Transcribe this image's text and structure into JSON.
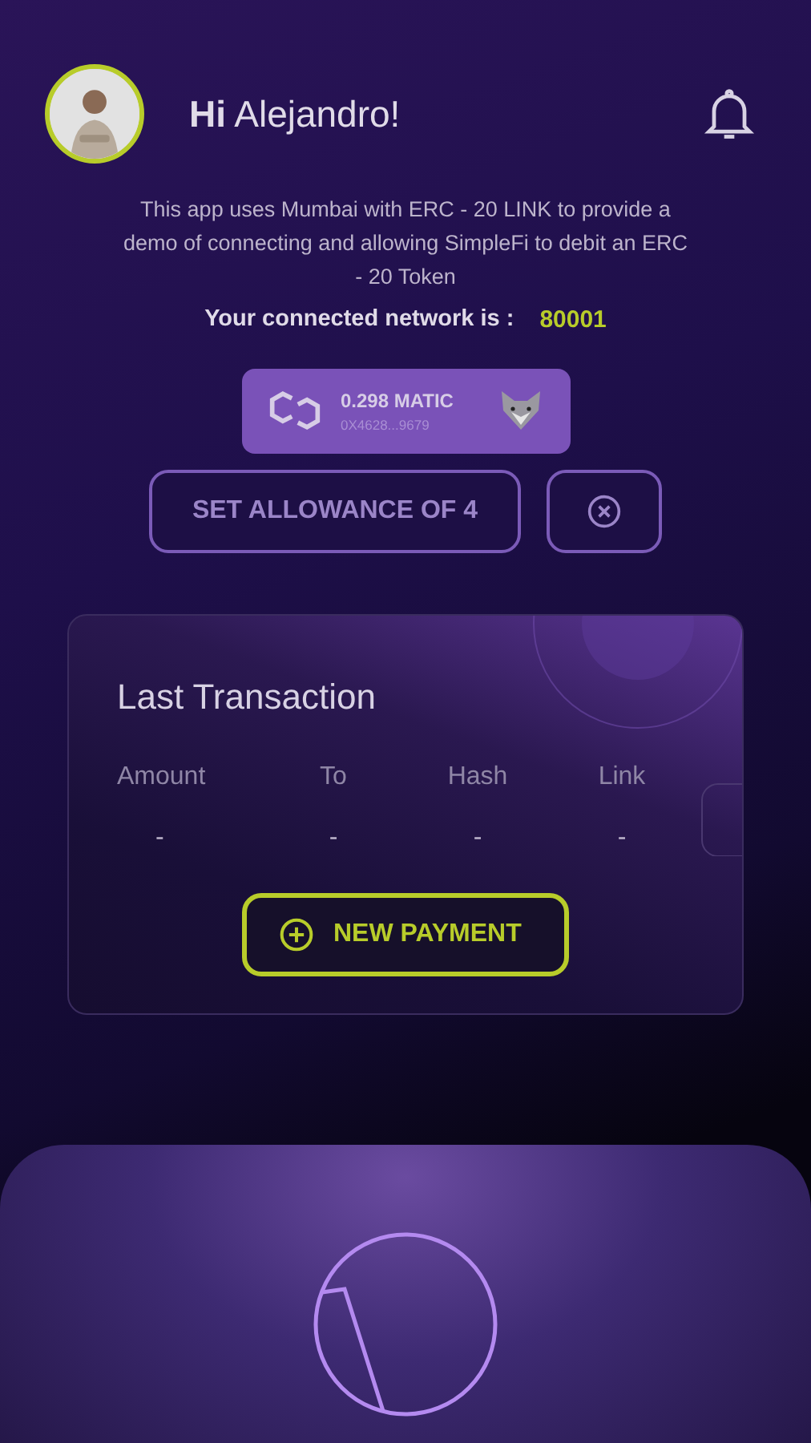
{
  "header": {
    "greeting_prefix": "Hi",
    "name": "Alejandro!"
  },
  "intro": "This app uses Mumbai with ERC - 20 LINK to provide a demo of connecting and allowing SimpleFi to debit an  ERC - 20 Token",
  "network": {
    "label": "Your connected network is :",
    "value": "80001"
  },
  "wallet": {
    "balance": "0.298 MATIC",
    "address": "0X4628...9679"
  },
  "allowance_button": "SET ALLOWANCE OF 4",
  "last_transaction": {
    "title": "Last Transaction",
    "columns": [
      "Amount",
      "To",
      "Hash",
      "Link"
    ],
    "values": [
      "-",
      "-",
      "-",
      "-"
    ],
    "button": "NEW PAYMENT"
  }
}
